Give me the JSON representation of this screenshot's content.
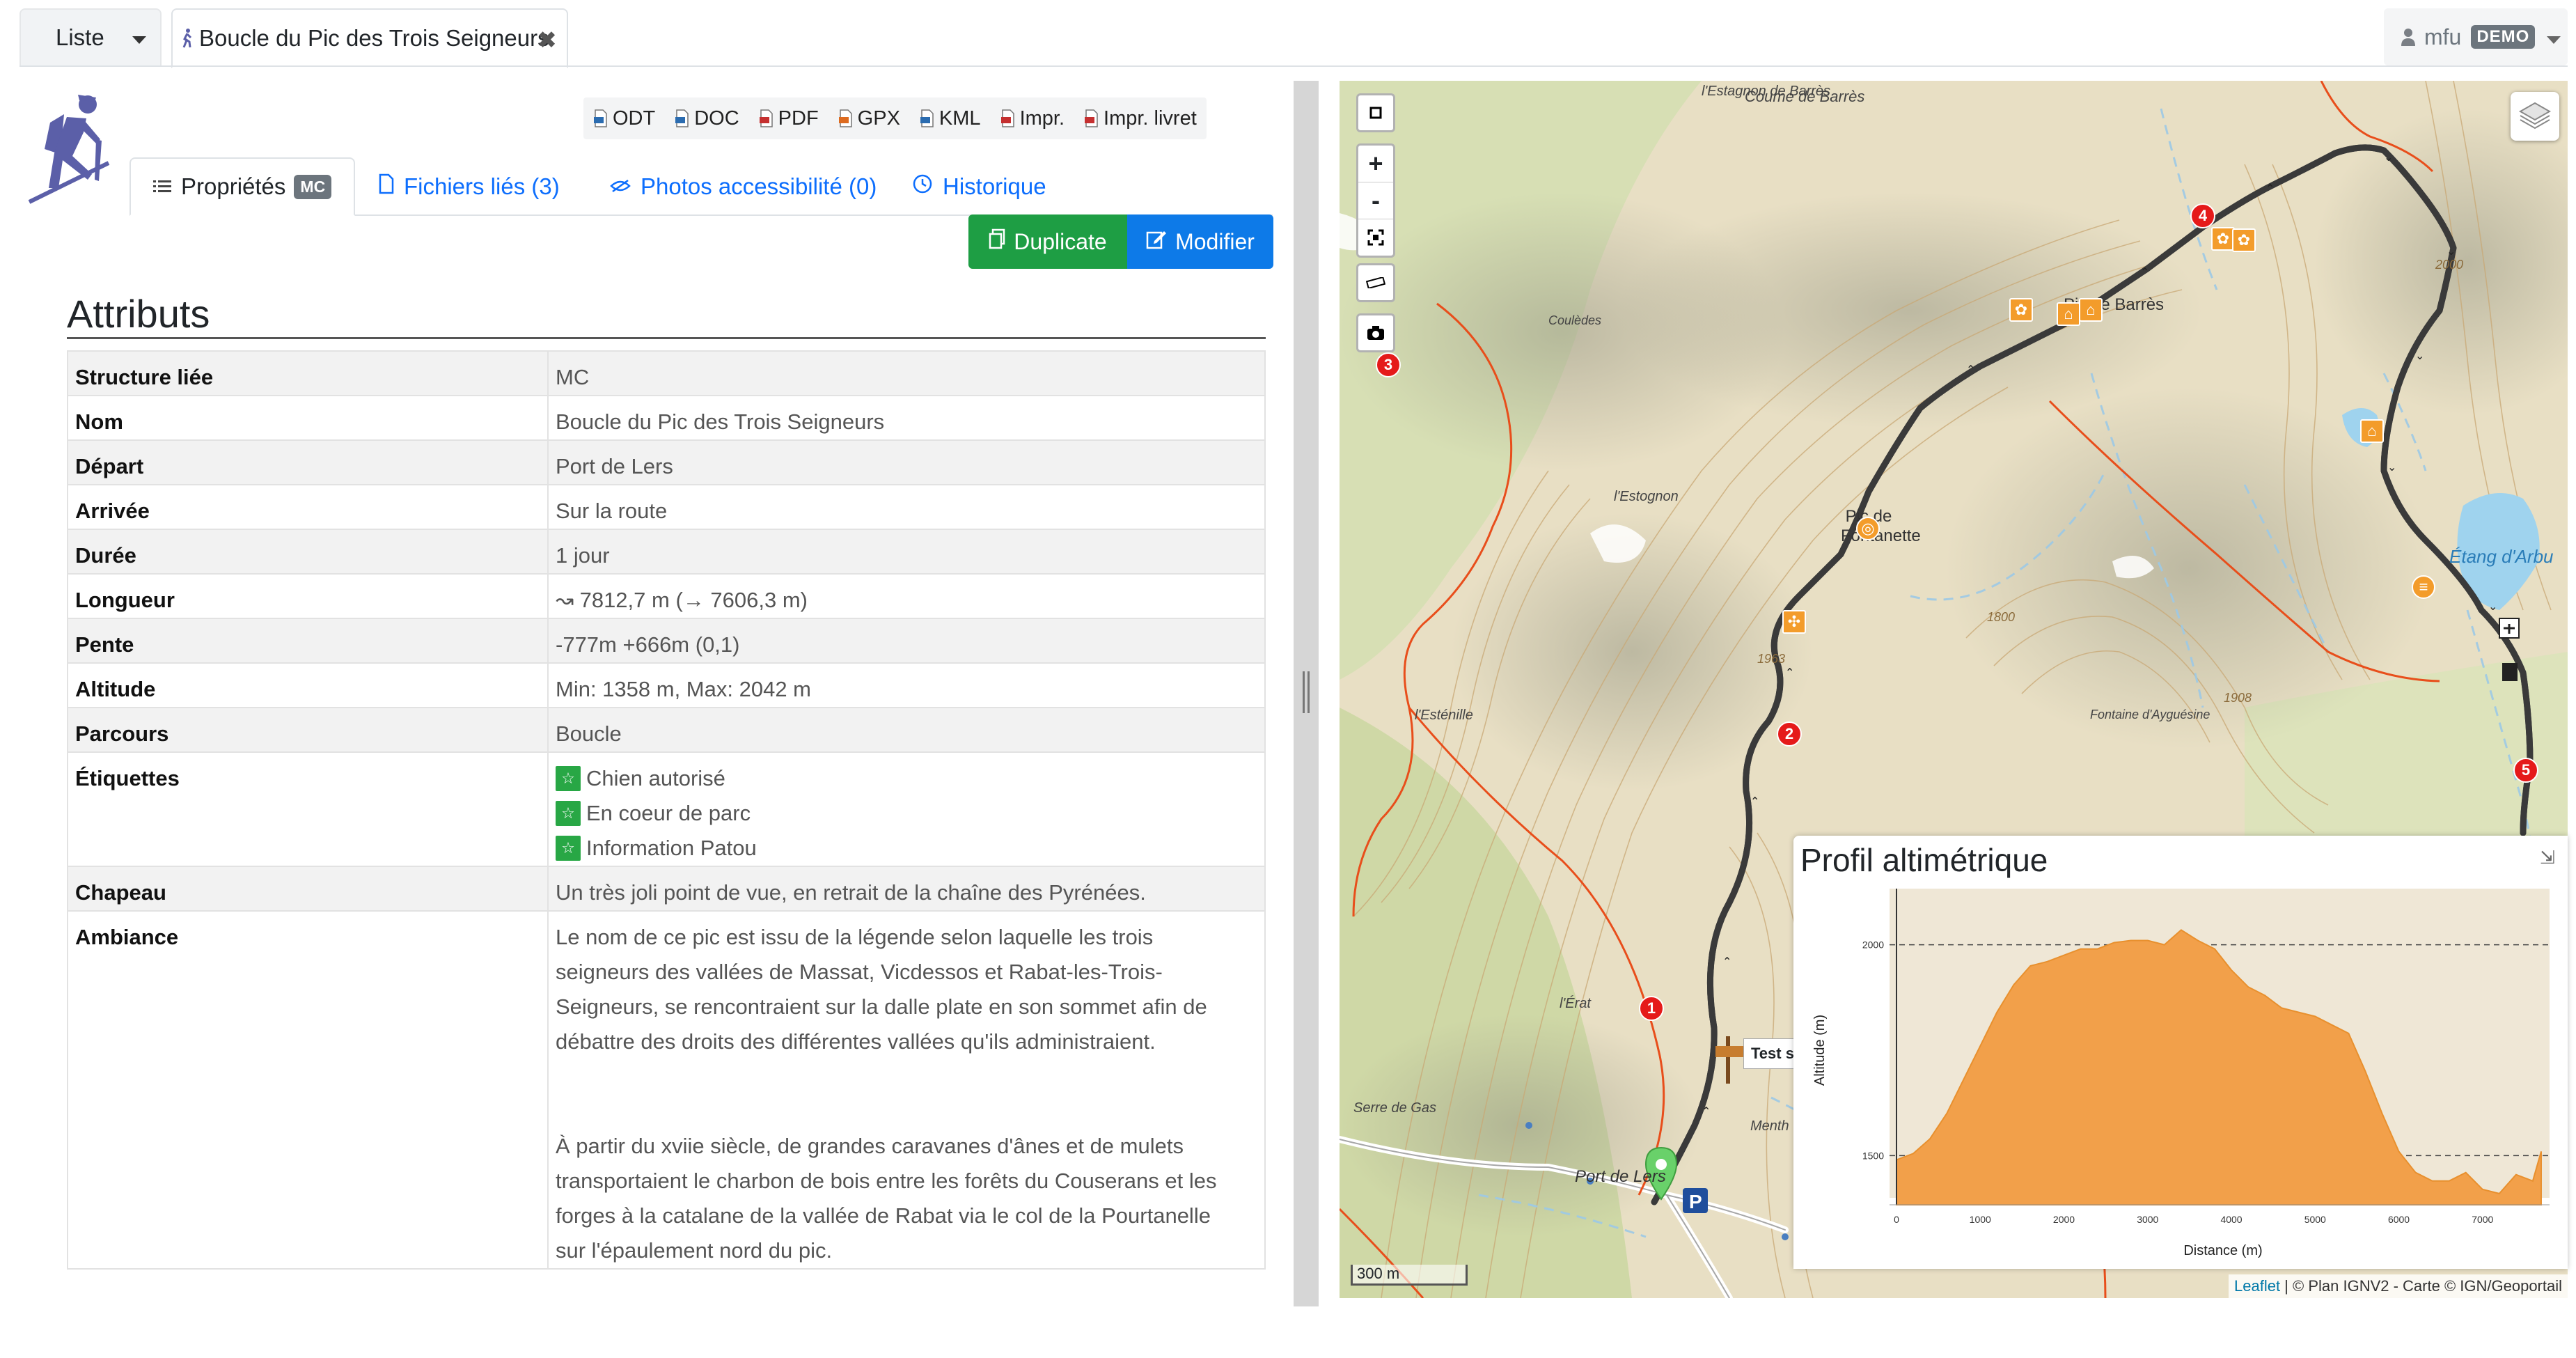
{
  "topnav": {
    "liste_label": "Liste",
    "record_tab_title": "Boucle du Pic des Trois Seigneurs",
    "close_glyph": "✖",
    "user_name": "mfu",
    "user_badge": "DEMO"
  },
  "exports": [
    "ODT",
    "DOC",
    "PDF",
    "GPX",
    "KML",
    "Impr.",
    "Impr. livret"
  ],
  "tabs": {
    "properties": "Propriétés",
    "properties_badge": "MC",
    "files": "Fichiers liés (3)",
    "photos": "Photos accessibilité (0)",
    "history": "Historique"
  },
  "actions": {
    "duplicate": "Duplicate",
    "modify": "Modifier"
  },
  "section_title": "Attributs",
  "attributes": {
    "structure": {
      "label": "Structure liée",
      "value": "MC"
    },
    "nom": {
      "label": "Nom",
      "value": "Boucle du Pic des Trois Seigneurs"
    },
    "depart": {
      "label": "Départ",
      "value": "Port de Lers"
    },
    "arrivee": {
      "label": "Arrivée",
      "value": "Sur la route"
    },
    "duree": {
      "label": "Durée",
      "value": "1 jour"
    },
    "longueur": {
      "label": "Longueur",
      "value": "↝ 7812,7 m (→ 7606,3 m)"
    },
    "pente": {
      "label": "Pente",
      "value": "-777m +666m (0,1)"
    },
    "altitude": {
      "label": "Altitude",
      "value": "Min: 1358 m, Max: 2042 m"
    },
    "parcours": {
      "label": "Parcours",
      "value": "Boucle"
    },
    "etiquettes": {
      "label": "Étiquettes",
      "values": [
        "Chien autorisé",
        "En coeur de parc",
        "Information Patou"
      ]
    },
    "chapeau": {
      "label": "Chapeau",
      "value": "Un très joli point de vue, en retrait de la chaîne des Pyrénées."
    },
    "ambiance": {
      "label": "Ambiance",
      "p1_lines": [
        "Le nom de ce pic est issu de la légende selon laquelle les trois",
        "seigneurs des vallées de Massat, Vicdessos et Rabat-les-Trois-",
        "Seigneurs, se rencontraient sur la dalle plate en son sommet afin de",
        "débattre des droits des différentes vallées qu'ils administraient."
      ],
      "p2_lines": [
        "À partir du xviie siècle, de grandes caravanes d'ânes et de mulets",
        "transportaient le charbon de bois entre les forêts du Couserans et les",
        "forges à la catalane de la vallée de Rabat via le col de la Pourtanelle",
        "sur l'épaulement nord du pic."
      ]
    }
  },
  "map": {
    "zoom_in": "+",
    "zoom_out": "-",
    "labels": {
      "coume": "Coume de Barrès",
      "estagnon_barres": "l'Estagnon de Barrès",
      "coulèdes": "Coulèdes",
      "pic_barres": "Pic de Barrès",
      "estognon": "l'Estognon",
      "pic_fontanette": "Pic de Fontanette",
      "etang": "Étang d'Arbu",
      "estenille": "l'Esténille",
      "fontaine": "Fontaine d'Ayguésine",
      "erat": "l'Érat",
      "serre": "Serre de Gas",
      "port": "Port de Lers",
      "menth": "Menth",
      "alt_1963": "1963",
      "alt_2000": "2000",
      "alt_1800": "1800",
      "alt_1908": "1908",
      "test": "Test s"
    },
    "step_markers": [
      "1",
      "2",
      "3",
      "4",
      "5"
    ],
    "scale": "300 m",
    "attribution_link": "Leaflet",
    "attribution_rest": " | © Plan IGNV2 - Carte © IGN/Geoportail"
  },
  "profile": {
    "title": "Profil altimétrique",
    "collapse_glyph": "⇲"
  },
  "chart_data": {
    "type": "area",
    "title": "",
    "xlabel": "Distance (m)",
    "ylabel": "Altitude (m)",
    "xlim": [
      0,
      7800
    ],
    "ylim": [
      1400,
      2100
    ],
    "xticks": [
      "0",
      "1000",
      "2000",
      "3000",
      "4000",
      "5000",
      "6000",
      "7000"
    ],
    "yticks": [
      "1500",
      "2000"
    ],
    "x": [
      0,
      200,
      400,
      600,
      800,
      1000,
      1200,
      1400,
      1600,
      1800,
      2000,
      2200,
      2400,
      2600,
      2800,
      3000,
      3200,
      3400,
      3600,
      3800,
      4000,
      4200,
      4400,
      4600,
      4800,
      5000,
      5200,
      5400,
      5600,
      5800,
      6000,
      6200,
      6400,
      6600,
      6800,
      7000,
      7200,
      7400,
      7600,
      7700
    ],
    "y": [
      1490,
      1505,
      1540,
      1600,
      1680,
      1760,
      1840,
      1905,
      1950,
      1960,
      1975,
      1990,
      1990,
      2005,
      2010,
      2010,
      2000,
      2035,
      2010,
      1990,
      1940,
      1900,
      1880,
      1850,
      1840,
      1830,
      1810,
      1790,
      1700,
      1600,
      1510,
      1460,
      1440,
      1440,
      1460,
      1420,
      1410,
      1455,
      1440,
      1510
    ],
    "grid": "dashed at 1500 and 2000"
  }
}
